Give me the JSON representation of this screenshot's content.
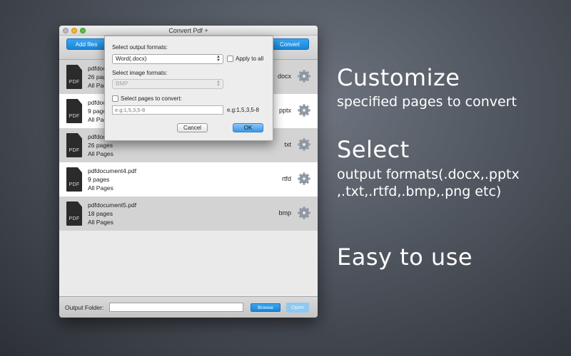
{
  "window": {
    "title": "Convert Pdf +",
    "add_files_label": "Add files",
    "convert_label": "Convert"
  },
  "files": [
    {
      "name": "pdfdocument1.pdf",
      "pages": "26 pages",
      "range": "All Pages",
      "format": "docx"
    },
    {
      "name": "pdfdocument2.pdf",
      "pages": "9 pages",
      "range": "All Pages",
      "format": "pptx"
    },
    {
      "name": "pdfdocument3.pdf",
      "pages": "26 pages",
      "range": "All Pages",
      "format": "txt"
    },
    {
      "name": "pdfdocument4.pdf",
      "pages": "9 pages",
      "range": "All Pages",
      "format": "rtfd"
    },
    {
      "name": "pdfdocument5.pdf",
      "pages": "18 pages",
      "range": "All Pages",
      "format": "bmp"
    }
  ],
  "file_icon_label": "PDF",
  "bottom": {
    "output_folder_label": "Output Folder:",
    "output_folder_value": "",
    "browse_label": "Browse",
    "open_label": "Open"
  },
  "dialog": {
    "output_formats_label": "Select output formats:",
    "output_format_value": "Word(.docx)",
    "apply_all_label": "Apply to all",
    "image_formats_label": "Select image formats:",
    "image_format_value": "BMP",
    "select_pages_label": "Select pages to convert:",
    "pages_placeholder": "e.g:1,5,3,5-8",
    "pages_example": "e.g:1,5,3,5-8",
    "cancel_label": "Cancel",
    "ok_label": "OK"
  },
  "promo": {
    "heading1": "Customize",
    "sub1": "specified pages to convert",
    "heading2": "Select",
    "sub2_line1": "output formats(.docx,.pptx",
    "sub2_line2": ",.txt,.rtfd,.bmp,.png etc)",
    "heading3": "Easy to use"
  },
  "colors": {
    "accent_blue": "#1a85d8",
    "row_gray": "#d3d3d3",
    "row_white": "#ffffff"
  }
}
